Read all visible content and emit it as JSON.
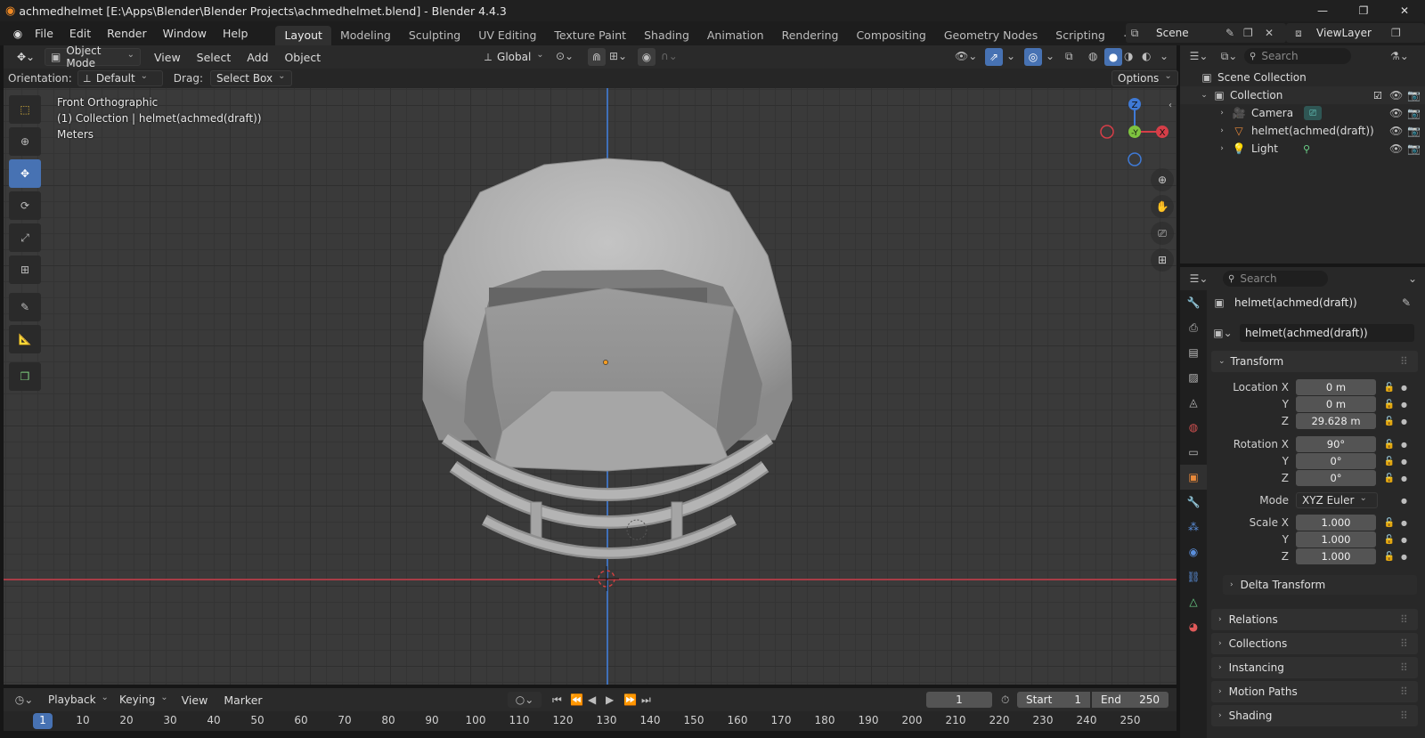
{
  "titlebar": {
    "title": "achmedhelmet [E:\\Apps\\Blender\\Blender Projects\\achmedhelmet.blend] - Blender 4.4.3"
  },
  "menubar": {
    "menus": [
      "File",
      "Edit",
      "Render",
      "Window",
      "Help"
    ],
    "workspaces": [
      "Layout",
      "Modeling",
      "Sculpting",
      "UV Editing",
      "Texture Paint",
      "Shading",
      "Animation",
      "Rendering",
      "Compositing",
      "Geometry Nodes",
      "Scripting"
    ],
    "active_workspace": "Layout",
    "scene": "Scene",
    "view_layer": "ViewLayer"
  },
  "viewport_header": {
    "mode": "Object Mode",
    "menus": [
      "View",
      "Select",
      "Add",
      "Object"
    ],
    "transform_orientation": "Global"
  },
  "tool_settings": {
    "orientation_label": "Orientation:",
    "orientation_value": "Default",
    "drag_label": "Drag:",
    "drag_value": "Select Box",
    "options_label": "Options"
  },
  "viewport": {
    "view_name": "Front Orthographic",
    "collection_info": "(1) Collection | helmet(achmed(draft))",
    "units": "Meters",
    "gizmo": {
      "z": "Z",
      "y": "-Y",
      "x": "X"
    }
  },
  "outliner": {
    "search_placeholder": "Search",
    "scene_collection": "Scene Collection",
    "collection": "Collection",
    "objects": [
      "Camera",
      "helmet(achmed(draft))",
      "Light"
    ]
  },
  "properties": {
    "search_placeholder": "Search",
    "object_name": "helmet(achmed(draft))",
    "object_field": "helmet(achmed(draft))",
    "transform_title": "Transform",
    "location": {
      "label": "Location X",
      "x": "0 m",
      "y": "0 m",
      "z": "29.628 m"
    },
    "rotation": {
      "label": "Rotation X",
      "x": "90°",
      "y": "0°",
      "z": "0°"
    },
    "mode_label": "Mode",
    "mode_value": "XYZ Euler",
    "scale": {
      "label": "Scale X",
      "x": "1.000",
      "y": "1.000",
      "z": "1.000"
    },
    "axis_y": "Y",
    "axis_z": "Z",
    "delta_transform": "Delta Transform",
    "sections": [
      "Relations",
      "Collections",
      "Instancing",
      "Motion Paths",
      "Shading"
    ]
  },
  "timeline": {
    "menus": [
      "Playback",
      "Keying",
      "View",
      "Marker"
    ],
    "current_frame": "1",
    "start_label": "Start",
    "start_value": "1",
    "end_label": "End",
    "end_value": "250",
    "ruler": [
      "1",
      "10",
      "20",
      "30",
      "40",
      "50",
      "60",
      "70",
      "80",
      "90",
      "100",
      "110",
      "120",
      "130",
      "140",
      "150",
      "160",
      "170",
      "180",
      "190",
      "200",
      "210",
      "220",
      "230",
      "240",
      "250"
    ]
  }
}
